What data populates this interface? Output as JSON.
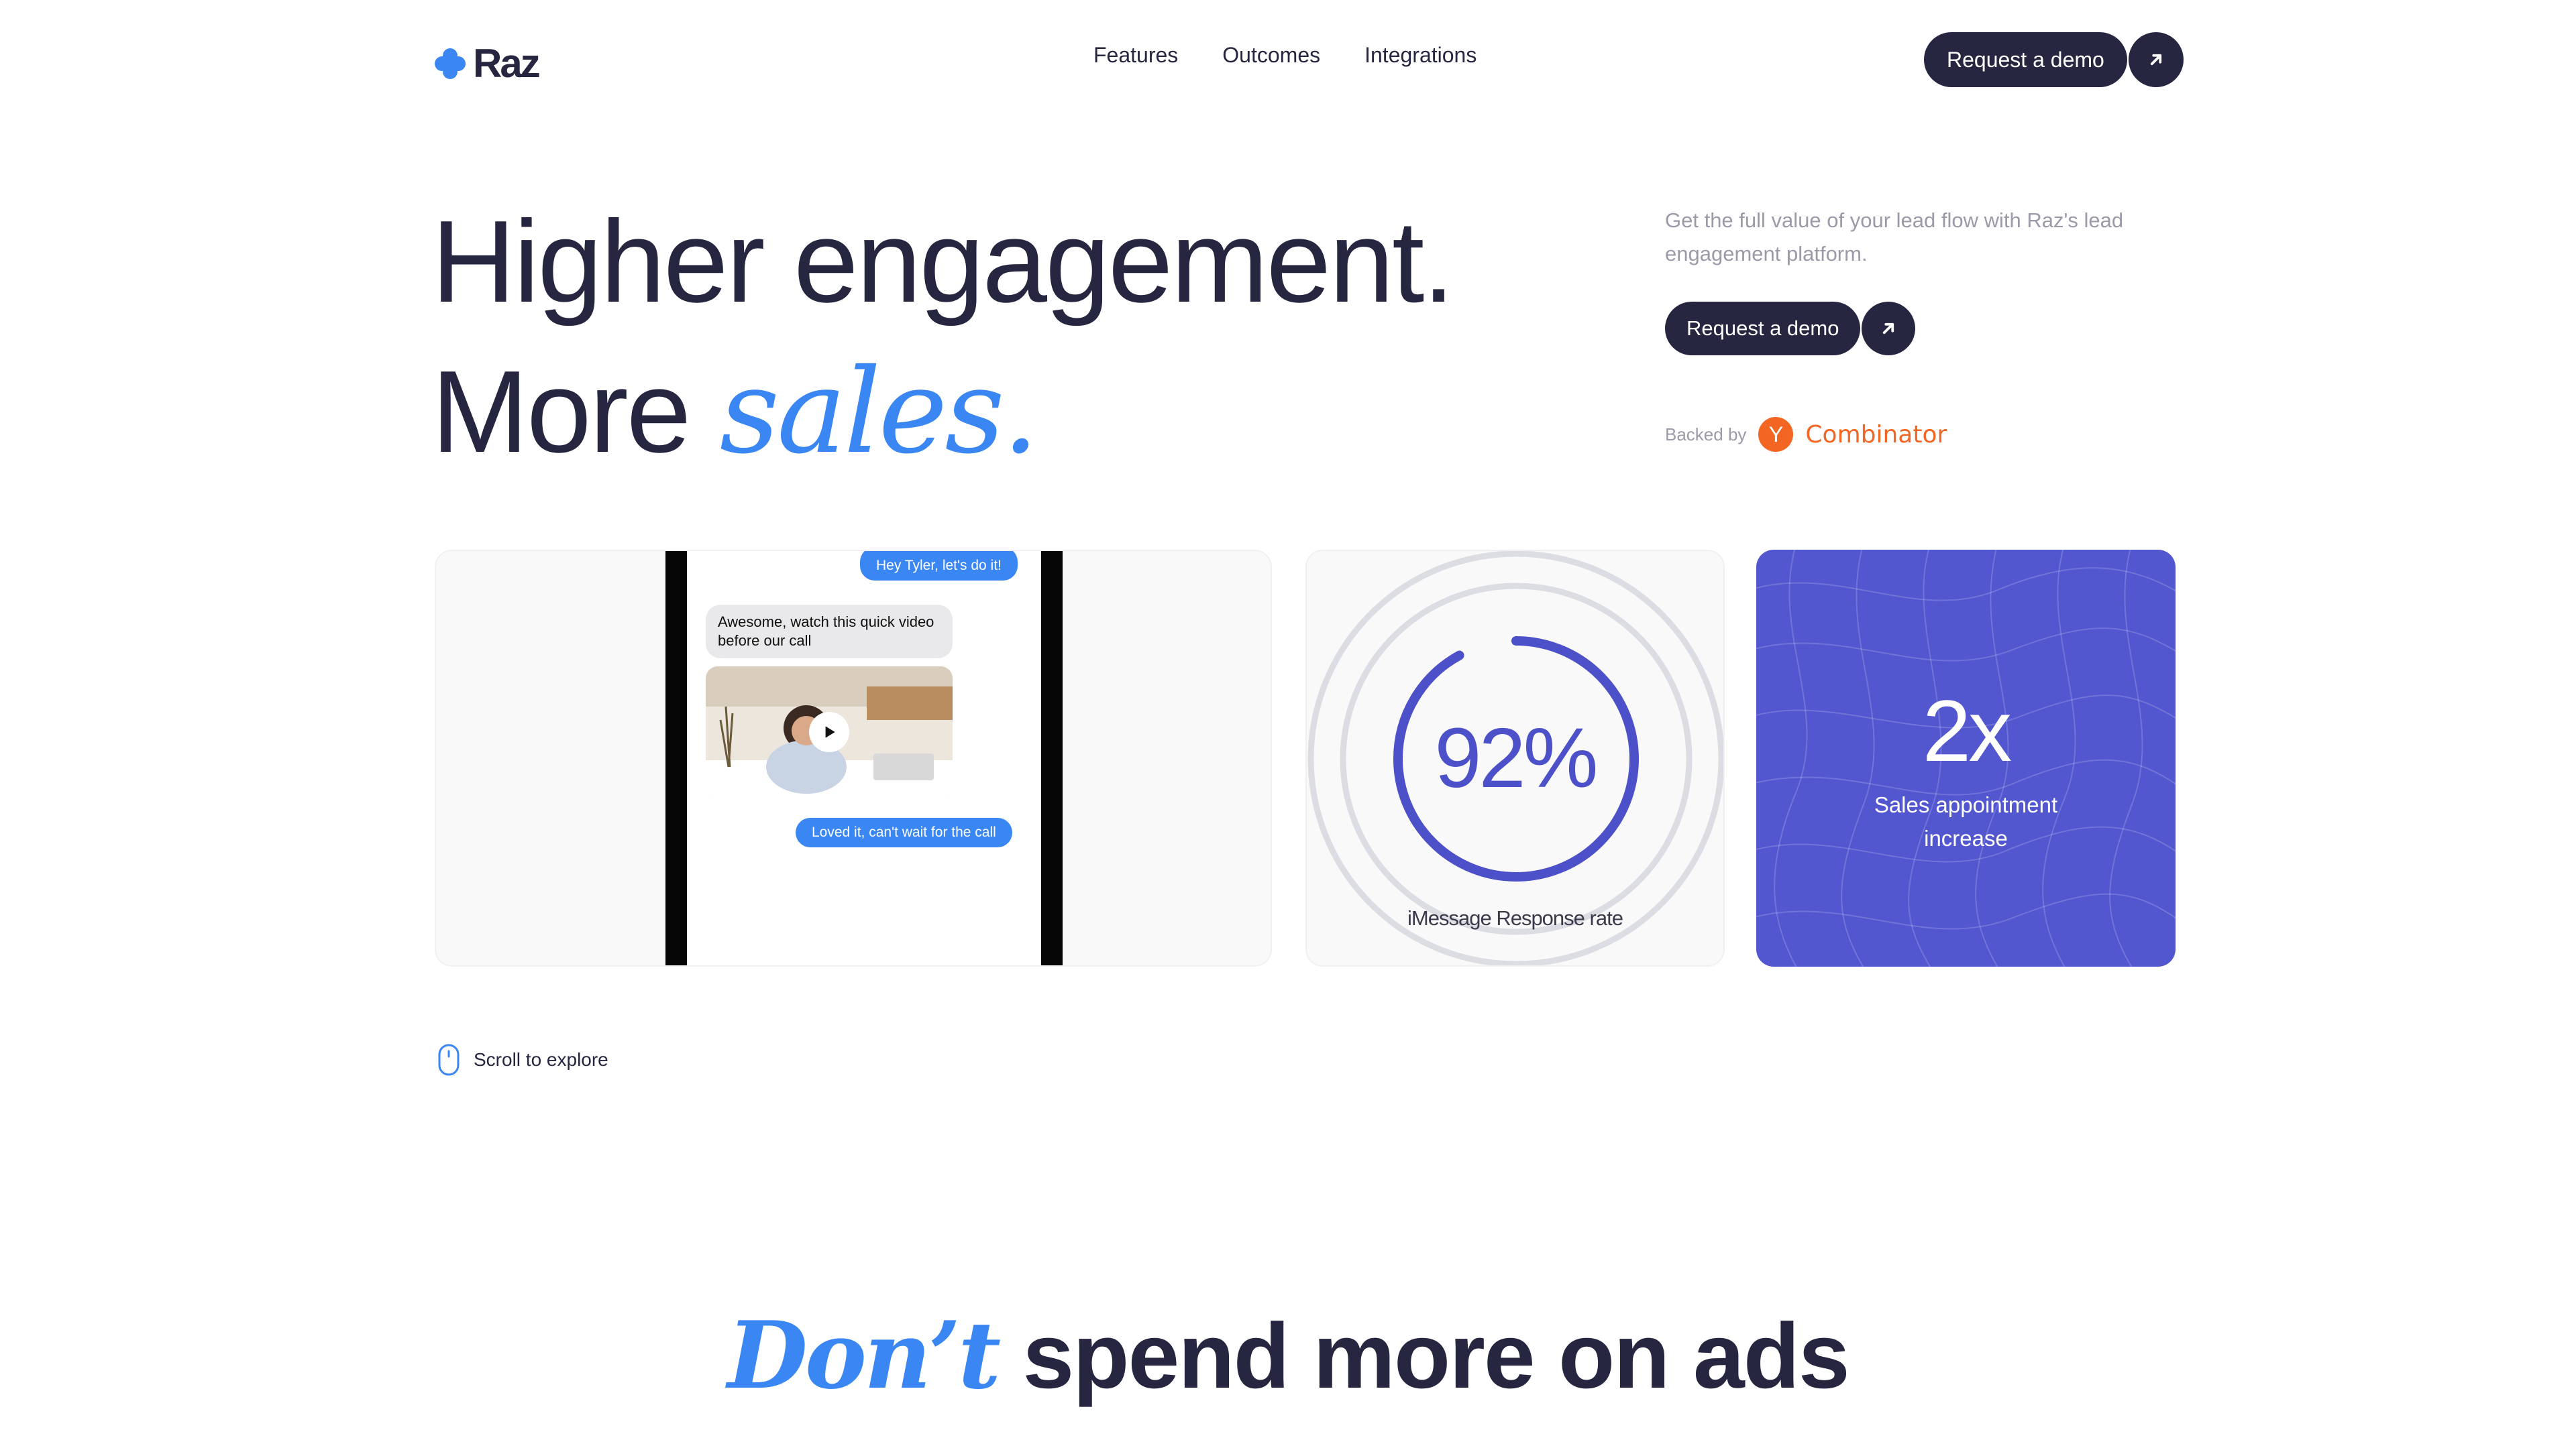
{
  "brand": {
    "name": "Raz",
    "accent": "#3a86f2",
    "dark": "#262640",
    "stat_bg": "#5256cf"
  },
  "nav": {
    "items": [
      "Features",
      "Outcomes",
      "Integrations"
    ]
  },
  "cta": {
    "label": "Request a demo",
    "icon": "arrow-up-right-icon"
  },
  "hero": {
    "line1": "Higher engagement.",
    "line2_prefix": "More",
    "line2_accent": "sales.",
    "subcopy": "Get the full value of your lead flow with Raz's lead engagement platform.",
    "backed_label": "Backed by",
    "yc_letter": "Y",
    "yc_name": "Combinator",
    "yc_color": "#f26522"
  },
  "phone_card": {
    "msg_top": "Hey Tyler, let's do it!",
    "msg_in": "Awesome, watch this quick video before our call",
    "msg_out": "Loved it, can't wait for the call",
    "video_icon": "play-icon"
  },
  "ring_card": {
    "value_label": "92%",
    "value_fraction": 0.92,
    "caption": "iMessage Response rate",
    "ring_color": "#4c51c9"
  },
  "stat_card": {
    "value": "2x",
    "caption": "Sales appointment increase"
  },
  "scroll": {
    "label": "Scroll to explore",
    "icon": "mouse-icon"
  },
  "section": {
    "accent": "Don’t",
    "rest": " spend more on ads"
  }
}
